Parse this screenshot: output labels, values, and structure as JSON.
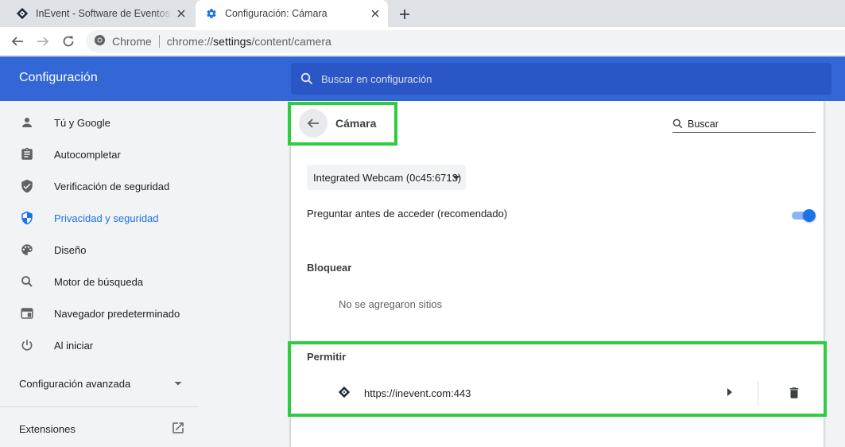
{
  "browser": {
    "tabs": [
      {
        "title": "InEvent - Software de Eventos Hí",
        "active": false
      },
      {
        "title": "Configuración: Cámara",
        "active": true
      }
    ],
    "omnibox": {
      "scheme_label": "Chrome",
      "url_host": "chrome://",
      "url_path": "settings",
      "url_rest": "/content/camera"
    }
  },
  "settings": {
    "title": "Configuración",
    "search_placeholder": "Buscar en configuración"
  },
  "sidebar": {
    "items": [
      {
        "label": "Tú y Google",
        "icon": "person-icon",
        "selected": false
      },
      {
        "label": "Autocompletar",
        "icon": "clipboard-icon",
        "selected": false
      },
      {
        "label": "Verificación de seguridad",
        "icon": "shield-check-icon",
        "selected": false
      },
      {
        "label": "Privacidad y seguridad",
        "icon": "shield-icon",
        "selected": true
      },
      {
        "label": "Diseño",
        "icon": "palette-icon",
        "selected": false
      },
      {
        "label": "Motor de búsqueda",
        "icon": "search-icon",
        "selected": false
      },
      {
        "label": "Navegador predeterminado",
        "icon": "browser-icon",
        "selected": false
      },
      {
        "label": "Al iniciar",
        "icon": "power-icon",
        "selected": false
      }
    ],
    "advanced_label": "Configuración avanzada",
    "extensions_label": "Extensiones"
  },
  "page": {
    "title": "Cámara",
    "search_placeholder": "Buscar",
    "device_selected": "Integrated Webcam (0c45:6713)",
    "ask_label": "Preguntar antes de acceder (recomendado)",
    "ask_enabled": true,
    "block": {
      "label": "Bloquear",
      "empty_text": "No se agregaron sitios"
    },
    "allow": {
      "label": "Permitir",
      "sites": [
        {
          "url": "https://inevent.com:443"
        }
      ]
    }
  },
  "colors": {
    "header_blue": "#3367d6",
    "accent": "#1a73e8",
    "highlight_green": "#2ecc40"
  }
}
